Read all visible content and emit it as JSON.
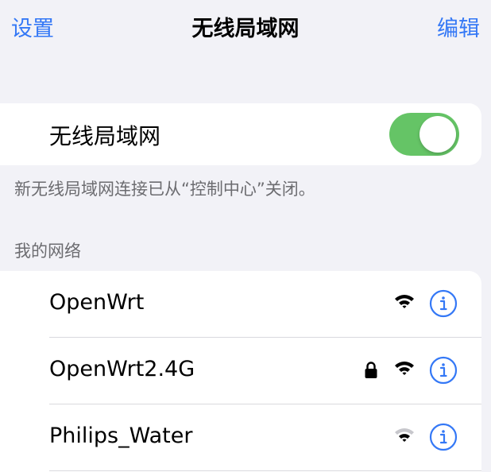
{
  "navbar": {
    "back_label": "设置",
    "title": "无线局域网",
    "edit_label": "编辑"
  },
  "wifi": {
    "label": "无线局域网",
    "enabled": true,
    "footnote": "新无线局域网连接已从“控制中心”关闭。"
  },
  "networks": {
    "header": "我的网络",
    "items": [
      {
        "name": "OpenWrt",
        "secured": false,
        "signal": "strong"
      },
      {
        "name": "OpenWrt2.4G",
        "secured": true,
        "signal": "strong"
      },
      {
        "name": "Philips_Water",
        "secured": false,
        "signal": "weak"
      }
    ]
  },
  "colors": {
    "accent": "#3478f6",
    "toggle_on": "#65c466",
    "background": "#f2f2f7"
  },
  "icons": [
    "lock-icon",
    "wifi-icon",
    "info-icon"
  ]
}
